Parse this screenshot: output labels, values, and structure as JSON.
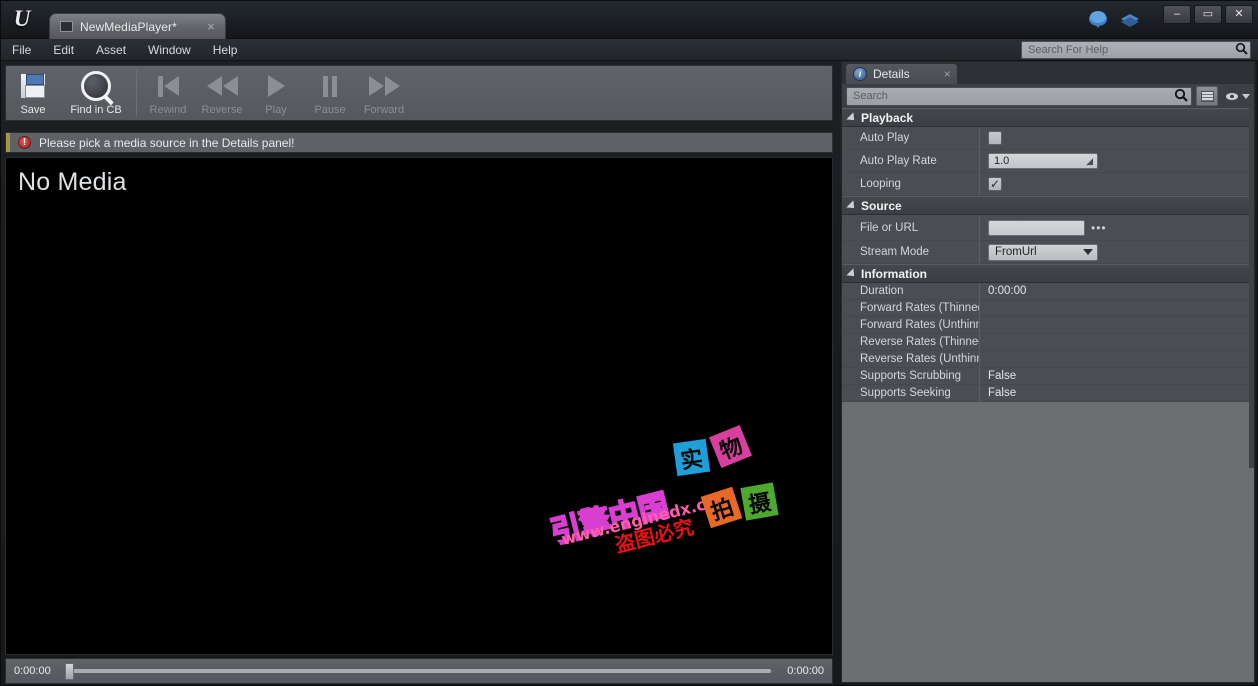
{
  "window": {
    "logo": "U",
    "tab": {
      "label": "NewMediaPlayer*",
      "close": "×",
      "icon": "media-asset-icon"
    },
    "controls": {
      "minimize": "–",
      "maximize": "▭",
      "close": "✕"
    },
    "right_icons": [
      "cloud-icon",
      "layers-icon"
    ]
  },
  "menubar": {
    "items": [
      {
        "label": "File"
      },
      {
        "label": "Edit"
      },
      {
        "label": "Asset"
      },
      {
        "label": "Window"
      },
      {
        "label": "Help"
      }
    ],
    "help_search": {
      "placeholder": "Search For Help",
      "value": "",
      "icon": "search-icon"
    }
  },
  "toolbar": {
    "buttons": [
      {
        "label": "Save",
        "icon": "floppy-icon",
        "enabled": true
      },
      {
        "label": "Find in CB",
        "icon": "magnifier-icon",
        "enabled": true
      },
      {
        "label": "Rewind",
        "icon": "rewind-icon",
        "enabled": false
      },
      {
        "label": "Reverse",
        "icon": "reverse-icon",
        "enabled": false
      },
      {
        "label": "Play",
        "icon": "play-icon",
        "enabled": false
      },
      {
        "label": "Pause",
        "icon": "pause-icon",
        "enabled": false
      },
      {
        "label": "Forward",
        "icon": "forward-icon",
        "enabled": false
      }
    ]
  },
  "notification": {
    "icon": "error-icon",
    "symbol": "!",
    "text": "Please pick a media source in the Details panel!",
    "accent_color": "#a79646"
  },
  "viewport": {
    "placeholder": "No Media",
    "watermark": {
      "brand": "引擎中国",
      "url": "www.enginedx.com",
      "notice": "盗图必究",
      "tiles": [
        {
          "char": "实",
          "color": "#1f9fd8"
        },
        {
          "char": "物",
          "color": "#d93f9e"
        },
        {
          "char": "摄",
          "color": "#4ea82e"
        },
        {
          "char": "拍",
          "color": "#e8682a"
        }
      ]
    }
  },
  "transport": {
    "current_time": "0:00:00",
    "total_time": "0:00:00",
    "scrub_position_percent": 0
  },
  "details": {
    "tab": {
      "label": "Details",
      "icon": "details-icon",
      "close": "×"
    },
    "search": {
      "placeholder": "Search",
      "value": "",
      "icon": "search-icon"
    },
    "view_buttons": [
      {
        "name": "grid-view-button",
        "icon": "grid-icon"
      },
      {
        "name": "visibility-options-button",
        "icon": "eye-icon"
      }
    ],
    "categories": [
      {
        "title": "Playback",
        "rows": [
          {
            "name": "Auto Play",
            "type": "checkbox",
            "value": false
          },
          {
            "name": "Auto Play Rate",
            "type": "spinner",
            "value": "1.0"
          },
          {
            "name": "Looping",
            "type": "checkbox",
            "value": true
          }
        ]
      },
      {
        "title": "Source",
        "rows": [
          {
            "name": "File or URL",
            "type": "textfield",
            "value": "",
            "browse": "•••"
          },
          {
            "name": "Stream Mode",
            "type": "combo",
            "value": "FromUrl"
          }
        ]
      },
      {
        "title": "Information",
        "rows": [
          {
            "name": "Duration",
            "type": "text",
            "value": "0:00:00"
          },
          {
            "name": "Forward Rates (Thinned",
            "type": "text",
            "value": ""
          },
          {
            "name": "Forward Rates (Unthinn",
            "type": "text",
            "value": ""
          },
          {
            "name": "Reverse Rates (Thinned",
            "type": "text",
            "value": ""
          },
          {
            "name": "Reverse Rates (Unthinn",
            "type": "text",
            "value": ""
          },
          {
            "name": "Supports Scrubbing",
            "type": "text",
            "value": "False"
          },
          {
            "name": "Supports Seeking",
            "type": "text",
            "value": "False"
          }
        ]
      }
    ]
  }
}
